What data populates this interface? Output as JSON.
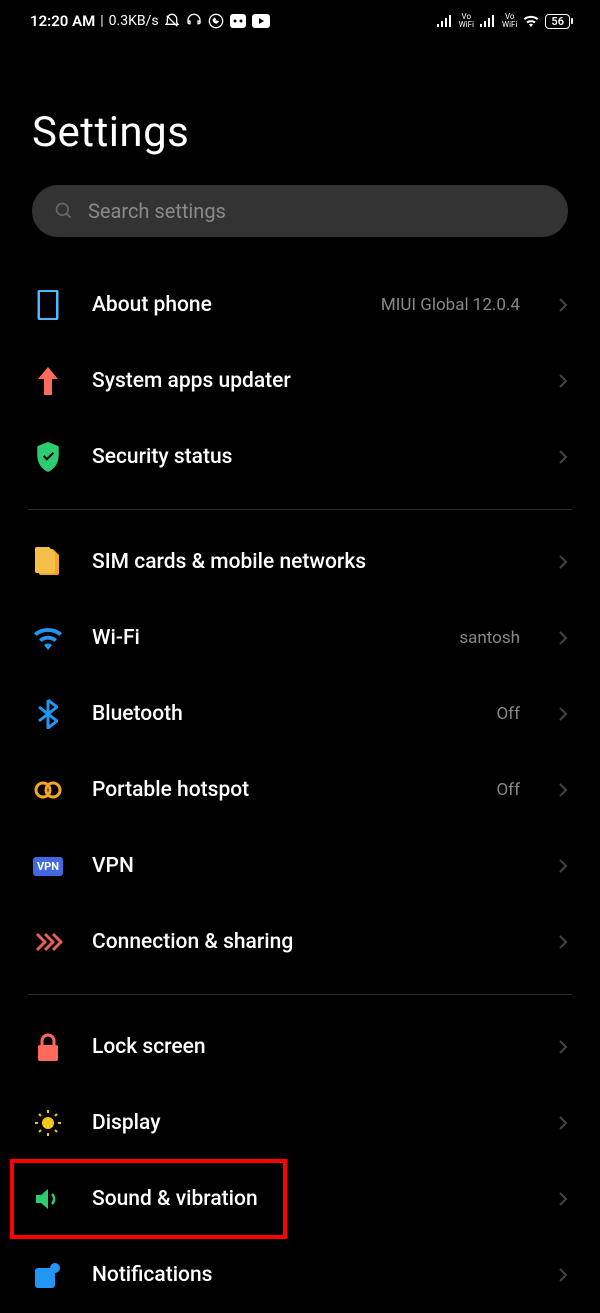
{
  "statusBar": {
    "time": "12:20 AM",
    "networkSpeed": "0.3KB/s",
    "battery": "56",
    "voWifi1": "Vo",
    "voWifi1b": "WiFi",
    "voWifi2": "Vo",
    "voWifi2b": "WiFi"
  },
  "title": "Settings",
  "search": {
    "placeholder": "Search settings"
  },
  "items": {
    "about": {
      "label": "About phone",
      "value": "MIUI Global 12.0.4"
    },
    "updater": {
      "label": "System apps updater"
    },
    "security": {
      "label": "Security status"
    },
    "sim": {
      "label": "SIM cards & mobile networks"
    },
    "wifi": {
      "label": "Wi-Fi",
      "value": "santosh"
    },
    "bluetooth": {
      "label": "Bluetooth",
      "value": "Off"
    },
    "hotspot": {
      "label": "Portable hotspot",
      "value": "Off"
    },
    "vpn": {
      "label": "VPN",
      "badge": "VPN"
    },
    "connection": {
      "label": "Connection & sharing"
    },
    "lock": {
      "label": "Lock screen"
    },
    "display": {
      "label": "Display"
    },
    "sound": {
      "label": "Sound & vibration"
    },
    "notifications": {
      "label": "Notifications"
    }
  }
}
